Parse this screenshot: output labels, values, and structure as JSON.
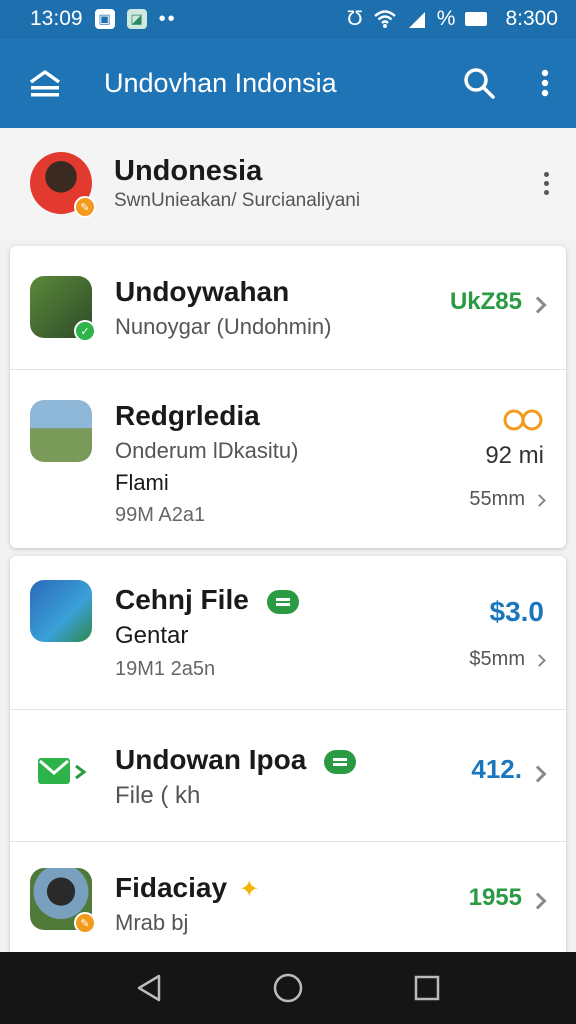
{
  "status_bar": {
    "time": "13:09",
    "battery_pct": "%",
    "clock_right": "8:300"
  },
  "app_bar": {
    "title": "Undovhan Indonsia"
  },
  "profile": {
    "name": "Undonesia",
    "subtitle": "SwnUnieakan/ Surcianaliyani"
  },
  "card1": {
    "rows": [
      {
        "title": "Undoywahan",
        "subtitle": "Nunoygar (Undohmin)",
        "value": "UkZ85"
      },
      {
        "title": "Redgrledia",
        "subtitle": "Onderum lDkasitu)",
        "line3": "Flami",
        "line4": "99M A2a1",
        "value_top": "92 mi",
        "value_bottom": "55mm"
      }
    ]
  },
  "card2": {
    "rows": [
      {
        "title": "Cehnj File",
        "subtitle": "Gentar",
        "line3": "19M1 2a5n",
        "value_top": "$3.0",
        "value_bottom": "$5mm"
      },
      {
        "title": "Undowan Ipoa",
        "subtitle": "File ( kh",
        "value": "412."
      },
      {
        "title": "Fidaciay",
        "subtitle": "Mrab bj",
        "value": "1955"
      }
    ]
  },
  "colors": {
    "app_bar": "#1f74b6",
    "status_bar": "#1d6fae",
    "green": "#2a9a43",
    "blue": "#1b77bd",
    "orange": "#f29b1d"
  }
}
